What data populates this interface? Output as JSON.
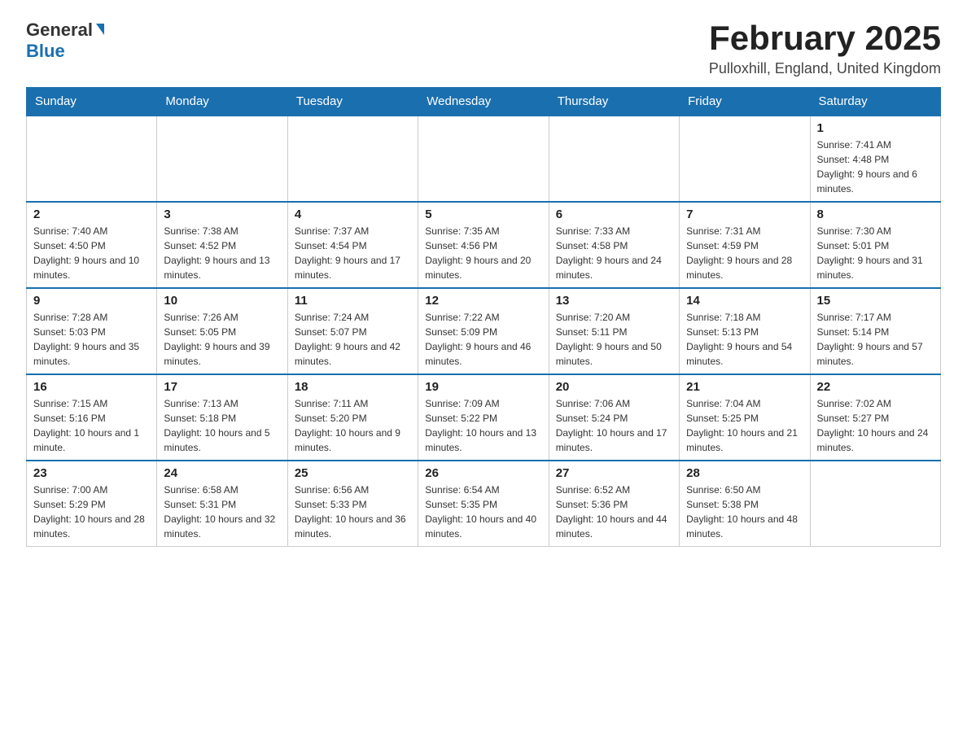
{
  "header": {
    "logo_general": "General",
    "logo_blue": "Blue",
    "month_title": "February 2025",
    "location": "Pulloxhill, England, United Kingdom"
  },
  "days_of_week": [
    "Sunday",
    "Monday",
    "Tuesday",
    "Wednesday",
    "Thursday",
    "Friday",
    "Saturday"
  ],
  "weeks": [
    {
      "days": [
        {
          "num": "",
          "info": ""
        },
        {
          "num": "",
          "info": ""
        },
        {
          "num": "",
          "info": ""
        },
        {
          "num": "",
          "info": ""
        },
        {
          "num": "",
          "info": ""
        },
        {
          "num": "",
          "info": ""
        },
        {
          "num": "1",
          "info": "Sunrise: 7:41 AM\nSunset: 4:48 PM\nDaylight: 9 hours and 6 minutes."
        }
      ]
    },
    {
      "days": [
        {
          "num": "2",
          "info": "Sunrise: 7:40 AM\nSunset: 4:50 PM\nDaylight: 9 hours and 10 minutes."
        },
        {
          "num": "3",
          "info": "Sunrise: 7:38 AM\nSunset: 4:52 PM\nDaylight: 9 hours and 13 minutes."
        },
        {
          "num": "4",
          "info": "Sunrise: 7:37 AM\nSunset: 4:54 PM\nDaylight: 9 hours and 17 minutes."
        },
        {
          "num": "5",
          "info": "Sunrise: 7:35 AM\nSunset: 4:56 PM\nDaylight: 9 hours and 20 minutes."
        },
        {
          "num": "6",
          "info": "Sunrise: 7:33 AM\nSunset: 4:58 PM\nDaylight: 9 hours and 24 minutes."
        },
        {
          "num": "7",
          "info": "Sunrise: 7:31 AM\nSunset: 4:59 PM\nDaylight: 9 hours and 28 minutes."
        },
        {
          "num": "8",
          "info": "Sunrise: 7:30 AM\nSunset: 5:01 PM\nDaylight: 9 hours and 31 minutes."
        }
      ]
    },
    {
      "days": [
        {
          "num": "9",
          "info": "Sunrise: 7:28 AM\nSunset: 5:03 PM\nDaylight: 9 hours and 35 minutes."
        },
        {
          "num": "10",
          "info": "Sunrise: 7:26 AM\nSunset: 5:05 PM\nDaylight: 9 hours and 39 minutes."
        },
        {
          "num": "11",
          "info": "Sunrise: 7:24 AM\nSunset: 5:07 PM\nDaylight: 9 hours and 42 minutes."
        },
        {
          "num": "12",
          "info": "Sunrise: 7:22 AM\nSunset: 5:09 PM\nDaylight: 9 hours and 46 minutes."
        },
        {
          "num": "13",
          "info": "Sunrise: 7:20 AM\nSunset: 5:11 PM\nDaylight: 9 hours and 50 minutes."
        },
        {
          "num": "14",
          "info": "Sunrise: 7:18 AM\nSunset: 5:13 PM\nDaylight: 9 hours and 54 minutes."
        },
        {
          "num": "15",
          "info": "Sunrise: 7:17 AM\nSunset: 5:14 PM\nDaylight: 9 hours and 57 minutes."
        }
      ]
    },
    {
      "days": [
        {
          "num": "16",
          "info": "Sunrise: 7:15 AM\nSunset: 5:16 PM\nDaylight: 10 hours and 1 minute."
        },
        {
          "num": "17",
          "info": "Sunrise: 7:13 AM\nSunset: 5:18 PM\nDaylight: 10 hours and 5 minutes."
        },
        {
          "num": "18",
          "info": "Sunrise: 7:11 AM\nSunset: 5:20 PM\nDaylight: 10 hours and 9 minutes."
        },
        {
          "num": "19",
          "info": "Sunrise: 7:09 AM\nSunset: 5:22 PM\nDaylight: 10 hours and 13 minutes."
        },
        {
          "num": "20",
          "info": "Sunrise: 7:06 AM\nSunset: 5:24 PM\nDaylight: 10 hours and 17 minutes."
        },
        {
          "num": "21",
          "info": "Sunrise: 7:04 AM\nSunset: 5:25 PM\nDaylight: 10 hours and 21 minutes."
        },
        {
          "num": "22",
          "info": "Sunrise: 7:02 AM\nSunset: 5:27 PM\nDaylight: 10 hours and 24 minutes."
        }
      ]
    },
    {
      "days": [
        {
          "num": "23",
          "info": "Sunrise: 7:00 AM\nSunset: 5:29 PM\nDaylight: 10 hours and 28 minutes."
        },
        {
          "num": "24",
          "info": "Sunrise: 6:58 AM\nSunset: 5:31 PM\nDaylight: 10 hours and 32 minutes."
        },
        {
          "num": "25",
          "info": "Sunrise: 6:56 AM\nSunset: 5:33 PM\nDaylight: 10 hours and 36 minutes."
        },
        {
          "num": "26",
          "info": "Sunrise: 6:54 AM\nSunset: 5:35 PM\nDaylight: 10 hours and 40 minutes."
        },
        {
          "num": "27",
          "info": "Sunrise: 6:52 AM\nSunset: 5:36 PM\nDaylight: 10 hours and 44 minutes."
        },
        {
          "num": "28",
          "info": "Sunrise: 6:50 AM\nSunset: 5:38 PM\nDaylight: 10 hours and 48 minutes."
        },
        {
          "num": "",
          "info": ""
        }
      ]
    }
  ]
}
